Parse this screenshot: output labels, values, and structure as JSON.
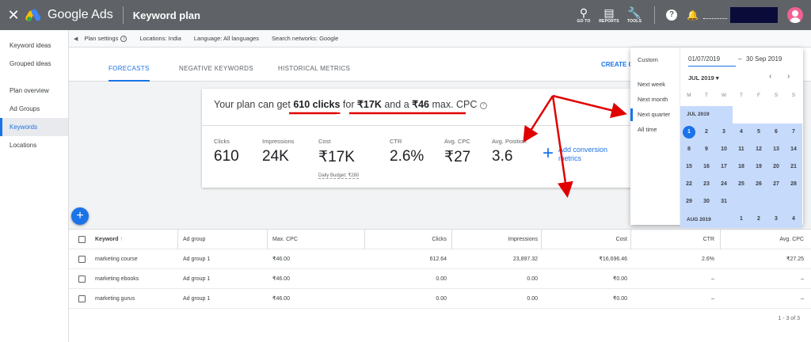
{
  "topbar": {
    "brand": "Google Ads",
    "title": "Keyword plan",
    "tools": [
      {
        "icon": "search-icon",
        "label": "GO TO"
      },
      {
        "icon": "reports-icon",
        "label": "REPORTS"
      },
      {
        "icon": "wrench-icon",
        "label": "TOOLS"
      }
    ]
  },
  "sidebar": {
    "items": [
      {
        "label": "Keyword ideas"
      },
      {
        "label": "Grouped ideas"
      },
      {
        "label": "Plan overview"
      },
      {
        "label": "Ad Groups"
      },
      {
        "label": "Keywords"
      },
      {
        "label": "Locations"
      }
    ],
    "active": "Keywords"
  },
  "settings": {
    "plan_settings": "Plan settings",
    "locations": "Locations: India",
    "language": "Language: All languages",
    "networks": "Search networks: Google"
  },
  "tabs": [
    {
      "label": "FORECASTS"
    },
    {
      "label": "NEGATIVE KEYWORDS"
    },
    {
      "label": "HISTORICAL METRICS"
    }
  ],
  "create_link": "CREATE C",
  "forecast": {
    "prefix": "Your plan can get",
    "clicks": "610 clicks",
    "mid1": "for",
    "cost": "₹17K",
    "mid2": "and a",
    "cpc": "₹46",
    "suffix": "max. CPC",
    "metrics": [
      {
        "label": "Clicks",
        "value": "610"
      },
      {
        "label": "Impressions",
        "value": "24K"
      },
      {
        "label": "Cost",
        "value": "₹17K",
        "sub": "Daily Budget: ₹280"
      },
      {
        "label": "CTR",
        "value": "2.6%"
      },
      {
        "label": "Avg. CPC",
        "value": "₹27"
      },
      {
        "label": "Avg. Position",
        "value": "3.6"
      }
    ],
    "add_conversion": "Add conversion metrics"
  },
  "table": {
    "headers": [
      "Keyword",
      "Ad group",
      "Max. CPC",
      "Clicks",
      "Impressions",
      "Cost",
      "CTR",
      "Avg. CPC"
    ],
    "rows": [
      [
        "marketing course",
        "Ad group 1",
        "₹46.00",
        "612.64",
        "23,897.32",
        "₹16,696.46",
        "2.6%",
        "₹27.25"
      ],
      [
        "marketing ebooks",
        "Ad group 1",
        "₹46.00",
        "0.00",
        "0.00",
        "₹0.00",
        "–",
        "–"
      ],
      [
        "marketing gurus",
        "Ad group 1",
        "₹46.00",
        "0.00",
        "0.00",
        "₹0.00",
        "–",
        "–"
      ]
    ],
    "pagination": "1 - 3 of 3"
  },
  "datepicker": {
    "options": [
      "Custom",
      "Next week",
      "Next month",
      "Next quarter",
      "All time"
    ],
    "active_option": "Next quarter",
    "from": "01/07/2019",
    "dash": "–",
    "to": "30 Sep 2019",
    "month_select": "JUL 2019",
    "weekdays": [
      "M",
      "T",
      "W",
      "T",
      "F",
      "S",
      "S"
    ],
    "month1_label": "JUL 2019",
    "month1_days": [
      "1",
      "2",
      "3",
      "4",
      "5",
      "6",
      "7",
      "8",
      "9",
      "10",
      "11",
      "12",
      "13",
      "14",
      "15",
      "16",
      "17",
      "18",
      "19",
      "20",
      "21",
      "22",
      "23",
      "24",
      "25",
      "26",
      "27",
      "28",
      "29",
      "30",
      "31"
    ],
    "month2_label": "AUG 2019",
    "month2_days": [
      "1",
      "2",
      "3",
      "4"
    ]
  },
  "colors": {
    "accent": "#1a73e8",
    "topbar": "#5f6368",
    "annotation": "#e00000",
    "range_highlight": "#c6dafc"
  }
}
